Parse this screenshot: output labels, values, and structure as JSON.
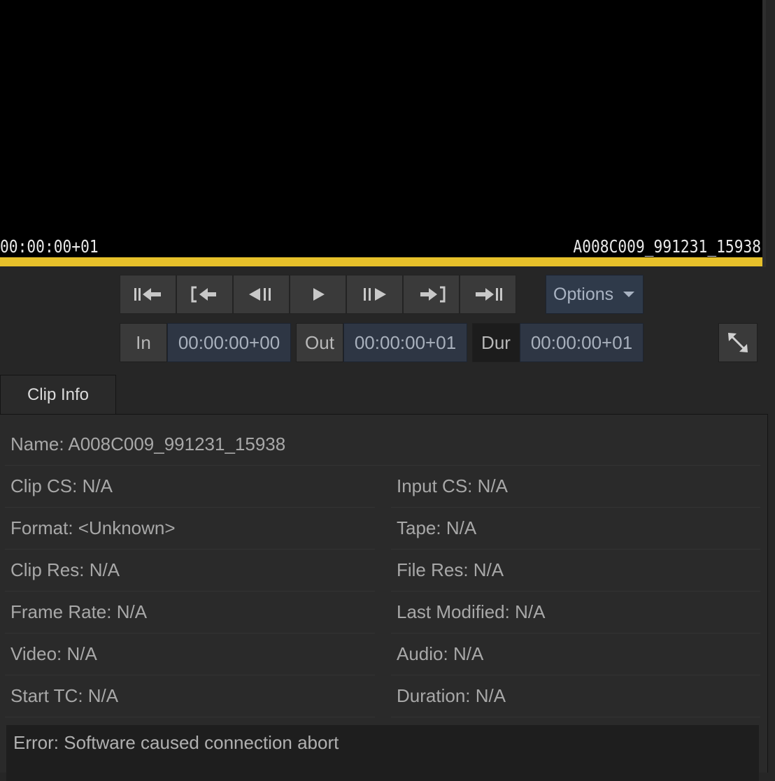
{
  "viewer": {
    "timecode_left": "00:00:00+01",
    "clip_name": "A008C009_991231_15938"
  },
  "transport": {
    "buttons": [
      {
        "name": "go-to-start",
        "icon": "skip-to-start-icon"
      },
      {
        "name": "go-to-in",
        "icon": "go-to-in-point-icon"
      },
      {
        "name": "step-back",
        "icon": "step-backward-icon"
      },
      {
        "name": "play",
        "icon": "play-icon"
      },
      {
        "name": "step-forward",
        "icon": "step-forward-icon"
      },
      {
        "name": "go-to-out",
        "icon": "go-to-out-point-icon"
      },
      {
        "name": "go-to-end",
        "icon": "skip-to-end-icon"
      }
    ],
    "options_label": "Options"
  },
  "inout": {
    "in_label": "In",
    "in_value": "00:00:00+00",
    "out_label": "Out",
    "out_value": "00:00:00+01",
    "dur_label": "Dur",
    "dur_value": "00:00:00+01"
  },
  "tab": {
    "label": "Clip Info"
  },
  "clip_info": {
    "name": "Name: A008C009_991231_15938",
    "left": [
      "Clip CS: N/A",
      "Format: <Unknown>",
      "Clip Res: N/A",
      "Frame Rate: N/A",
      "Video: N/A",
      "Start TC: N/A"
    ],
    "right": [
      "Input CS: N/A",
      "Tape: N/A",
      "File Res: N/A",
      "Last Modified: N/A",
      "Audio: N/A",
      "Duration: N/A"
    ],
    "error": "Error: Software caused connection abort"
  },
  "colors": {
    "scrubber": "#e6c02a",
    "background": "#262626",
    "field": "#2e3644"
  }
}
